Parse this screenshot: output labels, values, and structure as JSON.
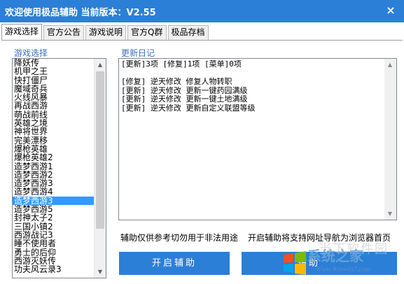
{
  "window": {
    "title": "欢迎使用极品辅助  当前版本：V2.55",
    "close_glyph": "×"
  },
  "tabs": [
    {
      "label": "游戏选择",
      "active": true
    },
    {
      "label": "官方公告",
      "active": false
    },
    {
      "label": "游戏说明",
      "active": false
    },
    {
      "label": "官方Q群",
      "active": false
    },
    {
      "label": "极品存档",
      "active": false
    }
  ],
  "game_list": {
    "group_label": "游戏选择",
    "selected_index": 16,
    "items": [
      "降妖传",
      "机甲之王",
      "快打僵尸",
      "魔域奇兵",
      "火线风暴",
      "再战西游",
      "萌战前线",
      "英雄之境",
      "神将世界",
      "完美漂移",
      "爆枪英雄",
      "爆枪英雄2",
      "造梦西游1",
      "造梦西游2",
      "造梦西游3",
      "造梦西游4",
      "造梦西游3",
      "造梦西游5",
      "封神太子2",
      "三国小镇2",
      "西游战记3",
      "睡不使用者",
      "勇士的后仰",
      "西游灭妖传",
      "功夫风云录3"
    ]
  },
  "update_log": {
    "group_label": "更新日记",
    "lines": [
      "[更新]3项 [修复]1项 [菜单]0项",
      "",
      "[修复] 逆天修改 修复人物转职",
      "[更新] 逆天修改 更新一键药园满级",
      "[更新] 逆天修改 更新一键土地满级",
      "[更新] 逆天修改 更新自定义联盟等级"
    ]
  },
  "notices": {
    "left": "辅助仅供参考切勿用于非法用途",
    "right": "开启辅助将支持网址导航为浏览器首页"
  },
  "buttons": {
    "start": "开启辅助",
    "second": "辅助"
  },
  "watermark": {
    "faint": "当下软件园",
    "brand": "系统之家",
    "url": "Www.Winwin7.com"
  },
  "colors": {
    "accent": "#2b7fd6",
    "selection": "#3399ff"
  }
}
